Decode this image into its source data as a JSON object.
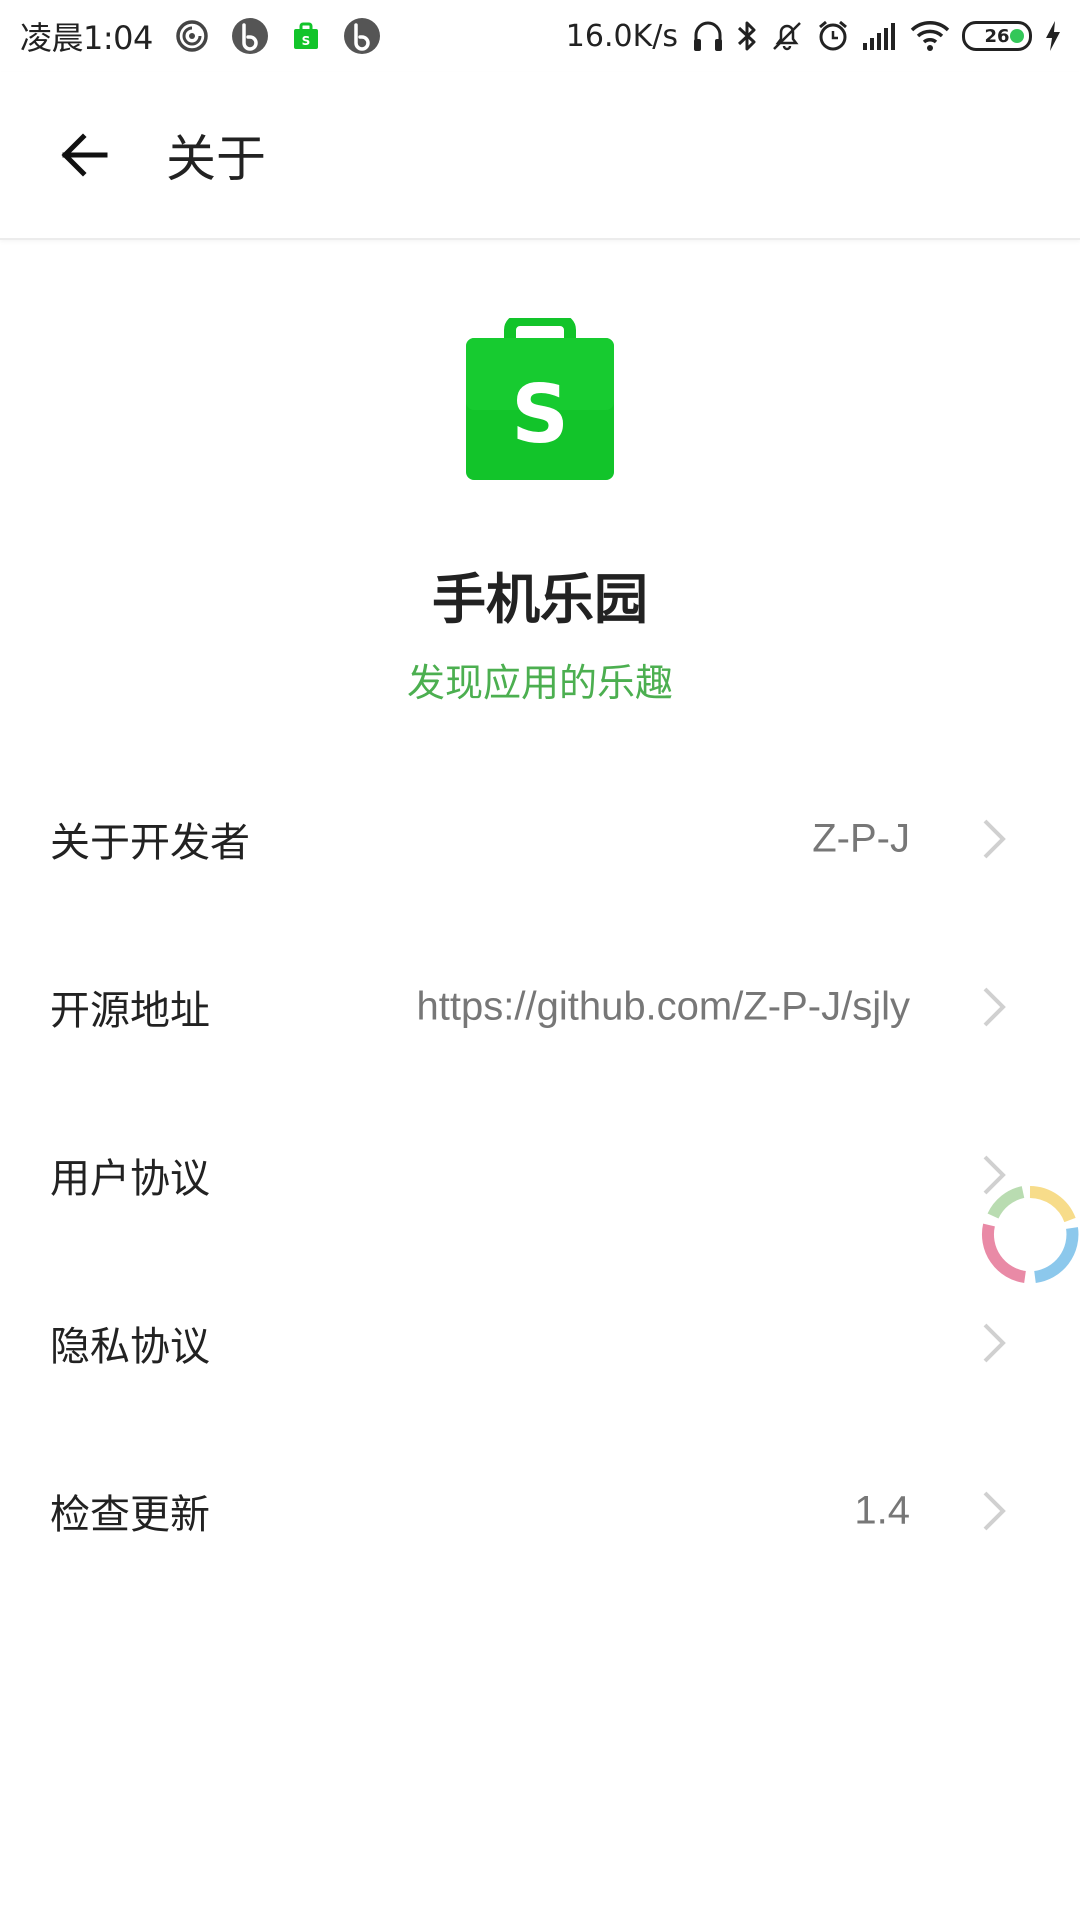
{
  "status_bar": {
    "time": "凌晨1:04",
    "network_speed": "16.0K/s",
    "battery_level": "26",
    "icons_left": [
      "netease-music-icon",
      "bilibili-icon",
      "shop-bag-icon",
      "bilibili-icon"
    ],
    "icons_right": [
      "headphones-icon",
      "bluetooth-icon",
      "mute-icon",
      "alarm-icon",
      "signal-icon",
      "wifi-icon",
      "battery-icon",
      "charging-icon"
    ]
  },
  "app_bar": {
    "title": "关于",
    "back_icon": "arrow-left-icon"
  },
  "app_info": {
    "logo_letter": "S",
    "name": "手机乐园",
    "slogan": "发现应用的乐趣",
    "brand_color": "#12c42a",
    "slogan_color": "#4caf50"
  },
  "settings": [
    {
      "label": "关于开发者",
      "value": "Z-P-J"
    },
    {
      "label": "开源地址",
      "value": "https://github.com/Z-P-J/sjly"
    },
    {
      "label": "用户协议",
      "value": ""
    },
    {
      "label": "隐私协议",
      "value": ""
    },
    {
      "label": "检查更新",
      "value": "1.4"
    }
  ]
}
